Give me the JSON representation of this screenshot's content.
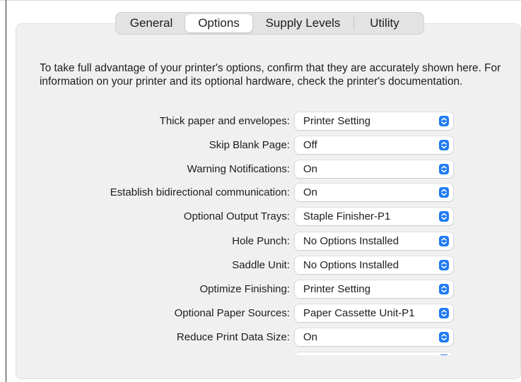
{
  "tabs": [
    {
      "label": "General",
      "active": false
    },
    {
      "label": "Options",
      "active": true
    },
    {
      "label": "Supply Levels",
      "active": false
    },
    {
      "label": "Utility",
      "active": false
    }
  ],
  "intro_text": "To take full advantage of your printer's options, confirm that they are accurately shown here. For information on your printer and its optional hardware, check the printer's documentation.",
  "options": [
    {
      "label": "Thick paper and envelopes:",
      "value": "Printer Setting"
    },
    {
      "label": "Skip Blank Page:",
      "value": "Off"
    },
    {
      "label": "Warning Notifications:",
      "value": "On"
    },
    {
      "label": "Establish bidirectional communication:",
      "value": "On"
    },
    {
      "label": "Optional Output Trays:",
      "value": "Staple Finisher-P1"
    },
    {
      "label": "Hole Punch:",
      "value": "No Options Installed"
    },
    {
      "label": "Saddle Unit:",
      "value": "No Options Installed"
    },
    {
      "label": "Optimize Finishing:",
      "value": "Printer Setting"
    },
    {
      "label": "Optional Paper Sources:",
      "value": "Paper Cassette Unit-P1"
    },
    {
      "label": "Reduce Print Data Size:",
      "value": "On"
    }
  ],
  "colors": {
    "accent": "#1f7bf2",
    "panel": "#f0f0f0"
  },
  "icons": {
    "popup_arrows": "chevron-up-down-icon"
  }
}
